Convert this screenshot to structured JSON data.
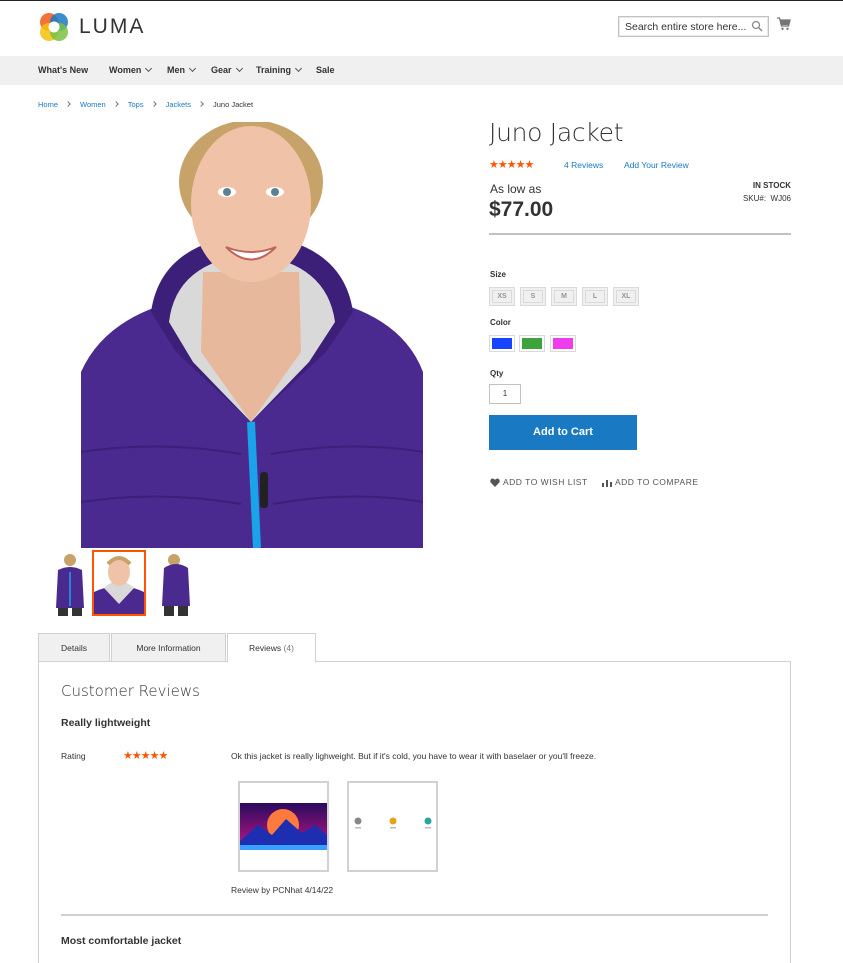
{
  "header": {
    "logo_text": "LUMA",
    "search_placeholder": "Search entire store here...",
    "nav": [
      "What's New",
      "Women",
      "Men",
      "Gear",
      "Training",
      "Sale"
    ]
  },
  "breadcrumb": [
    "Home",
    "Women",
    "Tops",
    "Jackets",
    "Juno Jacket"
  ],
  "product": {
    "title": "Juno Jacket",
    "stars": "★★★★★",
    "rating_fraction": 0.9,
    "reviews_count_label": "4  Reviews",
    "add_review_label": "Add Your Review",
    "as_low_as": "As low as",
    "price": "$77.00",
    "stock": "IN STOCK",
    "sku_label": "SKU#:",
    "sku": "WJ06",
    "size_label": "Size",
    "sizes": [
      "XS",
      "S",
      "M",
      "L",
      "XL"
    ],
    "color_label": "Color",
    "colors": [
      "#1745ff",
      "#3ea33c",
      "#ef3dee"
    ],
    "qty_label": "Qty",
    "qty": "1",
    "add_to_cart": "Add to Cart",
    "wish_list": "ADD TO WISH LIST",
    "compare": "ADD TO COMPARE"
  },
  "tabs": [
    {
      "label": "Details",
      "count": ""
    },
    {
      "label": "More Information",
      "count": ""
    },
    {
      "label": "Reviews",
      "count": "(4)"
    }
  ],
  "reviews": {
    "section_title": "Customer Reviews",
    "items": [
      {
        "title": "Really lightweight",
        "rating_label": "Rating",
        "stars": "★★★★★",
        "text": "Ok this jacket is really lighweight. But if it's cold, you have to wear it with baselaer or you'll freeze.",
        "byline": "Review by PCNhat 4/14/22"
      },
      {
        "title": "Most comfortable jacket"
      }
    ]
  },
  "colors": {
    "accent": "#1979c3",
    "star": "#ff5501",
    "jacket": "#4b2a8f"
  }
}
